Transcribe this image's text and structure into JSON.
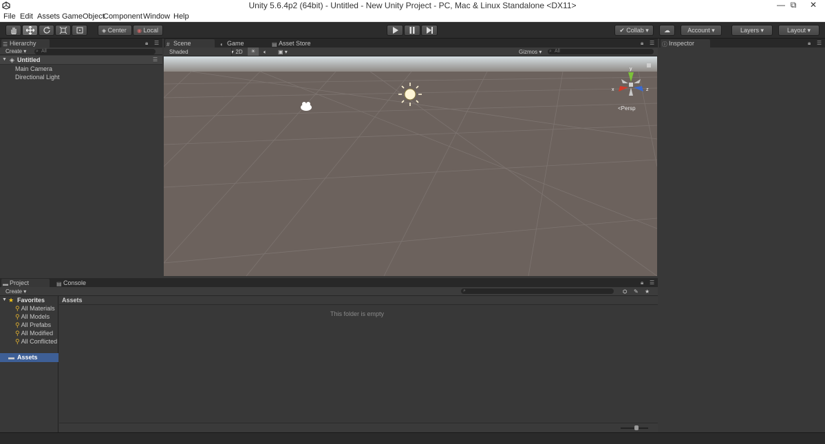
{
  "window": {
    "title": "Unity 5.6.4p2 (64bit) - Untitled - New Unity Project - PC, Mac & Linux Standalone <DX11>",
    "minimize": "—",
    "maximize": "⧉",
    "close": "✕"
  },
  "menu": [
    "File",
    "Edit",
    "Assets",
    "GameObject",
    "Component",
    "Window",
    "Help"
  ],
  "toolbar": {
    "pivot": "Center",
    "space": "Local",
    "collab": "Collab",
    "account": "Account",
    "layers": "Layers",
    "layout": "Layout"
  },
  "hierarchy": {
    "tab": "Hierarchy",
    "create": "Create",
    "search_placeholder": "All",
    "scene_name": "Untitled",
    "items": [
      "Main Camera",
      "Directional Light"
    ]
  },
  "scene_view": {
    "tabs": [
      "Scene",
      "Game",
      "Asset Store"
    ],
    "shading": "Shaded",
    "mode_2d": "2D",
    "gizmos": "Gizmos",
    "search_placeholder": "All",
    "gizmo_y": "y",
    "gizmo_x": "x",
    "gizmo_z": "z",
    "projection": "Persp"
  },
  "inspector": {
    "tab": "Inspector"
  },
  "project": {
    "tabs": [
      "Project",
      "Console"
    ],
    "create": "Create",
    "favorites_label": "Favorites",
    "favorites": [
      "All Materials",
      "All Models",
      "All Prefabs",
      "All Modified",
      "All Conflicted"
    ],
    "assets_root": "Assets",
    "breadcrumb": "Assets",
    "empty_message": "This folder is empty"
  },
  "colors": {
    "scene_ground": "#6c625d",
    "sky": "#c9d6dc",
    "gizmo_x": "#d23a2a",
    "gizmo_y": "#7cc23a",
    "gizmo_z": "#3a6ad2"
  }
}
